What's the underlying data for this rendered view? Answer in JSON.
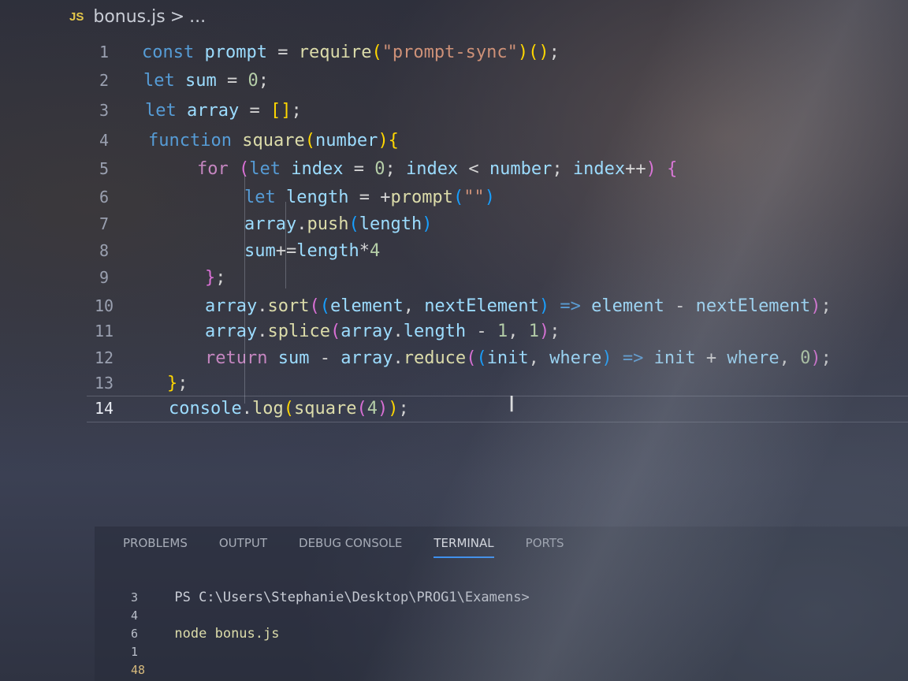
{
  "breadcrumb": {
    "file_badge": "JS",
    "file": "bonus.js",
    "separator": ">",
    "ellipsis": "..."
  },
  "editor": {
    "lines": [
      {
        "n": "1",
        "tokens": [
          [
            "kw",
            "const "
          ],
          [
            "var",
            "prompt"
          ],
          [
            "op",
            " = "
          ],
          [
            "fn",
            "require"
          ],
          [
            "br1",
            "("
          ],
          [
            "str",
            "\"prompt-sync\""
          ],
          [
            "br1",
            ")"
          ],
          [
            "br1",
            "()"
          ],
          [
            "op",
            ";"
          ]
        ]
      },
      {
        "n": "2",
        "tokens": [
          [
            "kw",
            "let "
          ],
          [
            "var",
            "sum"
          ],
          [
            "op",
            " = "
          ],
          [
            "num",
            "0"
          ],
          [
            "op",
            ";"
          ]
        ]
      },
      {
        "n": "3",
        "tokens": [
          [
            "kw",
            "let "
          ],
          [
            "var",
            "array"
          ],
          [
            "op",
            " = "
          ],
          [
            "br1",
            "[]"
          ],
          [
            "op",
            ";"
          ]
        ]
      },
      {
        "n": "4",
        "tokens": [
          [
            "kw",
            "function "
          ],
          [
            "fn",
            "square"
          ],
          [
            "br1",
            "("
          ],
          [
            "var",
            "number"
          ],
          [
            "br1",
            "){"
          ]
        ]
      },
      {
        "n": "5",
        "tokens": [
          [
            "ctl",
            "for "
          ],
          [
            "br2",
            "("
          ],
          [
            "kw",
            "let "
          ],
          [
            "var",
            "index"
          ],
          [
            "op",
            " = "
          ],
          [
            "num",
            "0"
          ],
          [
            "op",
            "; "
          ],
          [
            "var",
            "index"
          ],
          [
            "op",
            " < "
          ],
          [
            "var",
            "number"
          ],
          [
            "op",
            "; "
          ],
          [
            "var",
            "index"
          ],
          [
            "op",
            "++"
          ],
          [
            "br2",
            ")"
          ],
          [
            "op",
            " "
          ],
          [
            "br2",
            "{"
          ]
        ]
      },
      {
        "n": "6",
        "tokens": [
          [
            "kw",
            "let "
          ],
          [
            "var",
            "length"
          ],
          [
            "op",
            " = +"
          ],
          [
            "fn",
            "prompt"
          ],
          [
            "br3",
            "("
          ],
          [
            "str",
            "\"\""
          ],
          [
            "br3",
            ")"
          ]
        ]
      },
      {
        "n": "7",
        "tokens": [
          [
            "var",
            "array"
          ],
          [
            "op",
            "."
          ],
          [
            "fn",
            "push"
          ],
          [
            "br3",
            "("
          ],
          [
            "var",
            "length"
          ],
          [
            "br3",
            ")"
          ]
        ]
      },
      {
        "n": "8",
        "tokens": [
          [
            "var",
            "sum"
          ],
          [
            "op",
            "+="
          ],
          [
            "var",
            "length"
          ],
          [
            "op",
            "*"
          ],
          [
            "num",
            "4"
          ]
        ]
      },
      {
        "n": "9",
        "tokens": [
          [
            "br2",
            "}"
          ],
          [
            "op",
            ";"
          ]
        ]
      },
      {
        "n": "10",
        "tokens": [
          [
            "var",
            "array"
          ],
          [
            "op",
            "."
          ],
          [
            "fn",
            "sort"
          ],
          [
            "br2",
            "("
          ],
          [
            "br3",
            "("
          ],
          [
            "var",
            "element"
          ],
          [
            "op",
            ", "
          ],
          [
            "var",
            "nextElement"
          ],
          [
            "br3",
            ")"
          ],
          [
            "kw",
            " => "
          ],
          [
            "var",
            "element"
          ],
          [
            "op",
            " - "
          ],
          [
            "var",
            "nextElement"
          ],
          [
            "br2",
            ")"
          ],
          [
            "op",
            ";"
          ]
        ]
      },
      {
        "n": "11",
        "tokens": [
          [
            "var",
            "array"
          ],
          [
            "op",
            "."
          ],
          [
            "fn",
            "splice"
          ],
          [
            "br2",
            "("
          ],
          [
            "var",
            "array"
          ],
          [
            "op",
            "."
          ],
          [
            "var",
            "length"
          ],
          [
            "op",
            " - "
          ],
          [
            "num",
            "1"
          ],
          [
            "op",
            ", "
          ],
          [
            "num",
            "1"
          ],
          [
            "br2",
            ")"
          ],
          [
            "op",
            ";"
          ]
        ]
      },
      {
        "n": "12",
        "tokens": [
          [
            "ctl",
            "return "
          ],
          [
            "var",
            "sum"
          ],
          [
            "op",
            " - "
          ],
          [
            "var",
            "array"
          ],
          [
            "op",
            "."
          ],
          [
            "fn",
            "reduce"
          ],
          [
            "br2",
            "("
          ],
          [
            "br3",
            "("
          ],
          [
            "var",
            "init"
          ],
          [
            "op",
            ", "
          ],
          [
            "var",
            "where"
          ],
          [
            "br3",
            ")"
          ],
          [
            "kw",
            " => "
          ],
          [
            "var",
            "init"
          ],
          [
            "op",
            " + "
          ],
          [
            "var",
            "where"
          ],
          [
            "op",
            ", "
          ],
          [
            "num",
            "0"
          ],
          [
            "br2",
            ")"
          ],
          [
            "op",
            ";"
          ]
        ]
      },
      {
        "n": "13",
        "tokens": [
          [
            "br1",
            "}"
          ],
          [
            "op",
            ";"
          ]
        ]
      },
      {
        "n": "14",
        "tokens": [
          [
            "var",
            "console"
          ],
          [
            "op",
            "."
          ],
          [
            "fn",
            "log"
          ],
          [
            "br1",
            "("
          ],
          [
            "fn",
            "square"
          ],
          [
            "br2",
            "("
          ],
          [
            "num",
            "4"
          ],
          [
            "br2",
            ")"
          ],
          [
            "br1",
            ")"
          ],
          [
            "op",
            ";"
          ]
        ]
      }
    ]
  },
  "panel": {
    "tabs": [
      "PROBLEMS",
      "OUTPUT",
      "DEBUG CONSOLE",
      "TERMINAL",
      "PORTS"
    ],
    "active_tab": "TERMINAL",
    "terminal": {
      "prompt": "PS C:\\Users\\Stephanie\\Desktop\\PROG1\\Examens>",
      "command": "node bonus.js",
      "inputs": [
        "3",
        "4",
        "6",
        "1"
      ],
      "result": "48"
    }
  },
  "colors": {
    "keyword": "#569cd6",
    "control": "#c586c0",
    "function": "#dcdcaa",
    "string": "#ce9178",
    "number": "#b5cea8",
    "variable": "#9cdcfe",
    "js_badge": "#e6c84a",
    "active_tab_underline": "#3794ff"
  },
  "icons": {
    "file_icon": "js-file-icon",
    "cursor": "text-cursor-icon"
  }
}
